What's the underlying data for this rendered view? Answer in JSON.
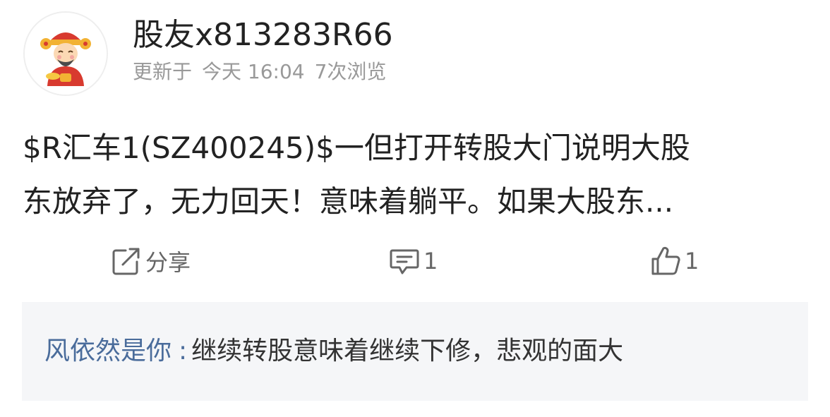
{
  "user": {
    "name": "股友x813283R66",
    "avatar_icon": "cartoon-fortune-god-avatar"
  },
  "meta": {
    "updated_label": "更新于",
    "time": "今天 16:04",
    "views": "7次浏览"
  },
  "post": {
    "line1": "$R汇车1(SZ400245)$一但打开转股大门说明大股",
    "line2": "东放弃了，无力回天！意味着躺平。如果大股东..."
  },
  "actions": {
    "share_label": "分享",
    "comment_count": "1",
    "like_count": "1"
  },
  "comments": [
    {
      "author": "风依然是你",
      "separator": ":",
      "text": "继续转股意味着继续下修，悲观的面大"
    }
  ],
  "colors": {
    "author_link": "#4a6c9b",
    "meta_gray": "#999999",
    "comment_bg": "#f5f6f8"
  }
}
